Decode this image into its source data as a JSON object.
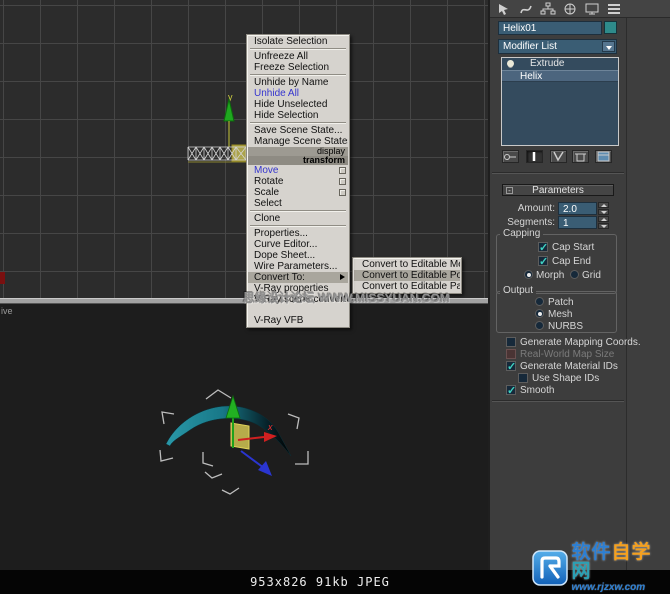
{
  "window": {
    "status_text": "953x826 91kb JPEG",
    "viewport_label_fragment": "ive"
  },
  "watermarks": {
    "center_text": "思缘设计论坛 WWW.MISSYUAN.COM",
    "logo_site_part1": "软件",
    "logo_site_part2": "自学",
    "logo_site_part3": "网",
    "logo_url": "www.rjzxw.com"
  },
  "scene": {
    "axis_label_x": "x",
    "axis_label_y": "y"
  },
  "quad_menu": {
    "section_titles": {
      "display": "display",
      "transform": "transform"
    },
    "display_items": [
      "Isolate Selection",
      "Unfreeze All",
      "Freeze Selection",
      "Unhide by Name",
      "Unhide All",
      "Hide Unselected",
      "Hide Selection",
      "Save Scene State...",
      "Manage Scene States..."
    ],
    "transform_items": [
      "Move",
      "Rotate",
      "Scale",
      "Select",
      "Clone",
      "Properties...",
      "Curve Editor...",
      "Dope Sheet...",
      "Wire Parameters...",
      "Convert To:",
      "V-Ray properties",
      "V-Ray scene converter",
      "V-Ray VFB"
    ],
    "highlighted_blue_items": [
      "Unhide All",
      "Move"
    ],
    "hovered_item": "Convert To:"
  },
  "submenu": {
    "items": [
      "Convert to Editable Mesh",
      "Convert to Editable Poly",
      "Convert to Editable Patch"
    ],
    "hovered_item": "Convert to Editable Poly"
  },
  "command_panel": {
    "object_name": "Helix01",
    "modifier_list_label": "Modifier List",
    "modifier_stack": [
      "Extrude",
      "Helix"
    ],
    "selected_modifier": "Helix",
    "tab_icons": [
      "create",
      "modify",
      "hierarchy",
      "motion",
      "display",
      "utilities"
    ],
    "stack_button_icons": [
      "pin-stack",
      "show-end-result",
      "make-unique",
      "remove-modifier",
      "configure-modifier-sets"
    ],
    "rollout_title": "Parameters",
    "parameters": {
      "amount_label": "Amount:",
      "amount_value": "2.0",
      "segments_label": "Segments:",
      "segments_value": "1"
    },
    "capping_group": {
      "title": "Capping",
      "cap_start_label": "Cap Start",
      "cap_end_label": "Cap End",
      "morph_label": "Morph",
      "grid_label": "Grid",
      "cap_start_checked": true,
      "cap_end_checked": true,
      "selected_radio": "Morph"
    },
    "output_group": {
      "title": "Output",
      "patch_label": "Patch",
      "mesh_label": "Mesh",
      "nurbs_label": "NURBS",
      "selected_radio": "Mesh"
    },
    "checkboxes": {
      "generate_mapping_label": "Generate Mapping Coords.",
      "real_world_label": "Real-World Map Size",
      "generate_material_label": "Generate Material IDs",
      "use_shape_label": "Use Shape IDs",
      "smooth_label": "Smooth",
      "generate_mapping_checked": false,
      "real_world_disabled": true,
      "generate_material_checked": true,
      "use_shape_checked": false,
      "smooth_checked": true
    },
    "colors": {
      "object_color_swatch": "#2e8b8b",
      "check_accent": "#3fd2c2",
      "field_bg": "#3a5d74"
    }
  }
}
